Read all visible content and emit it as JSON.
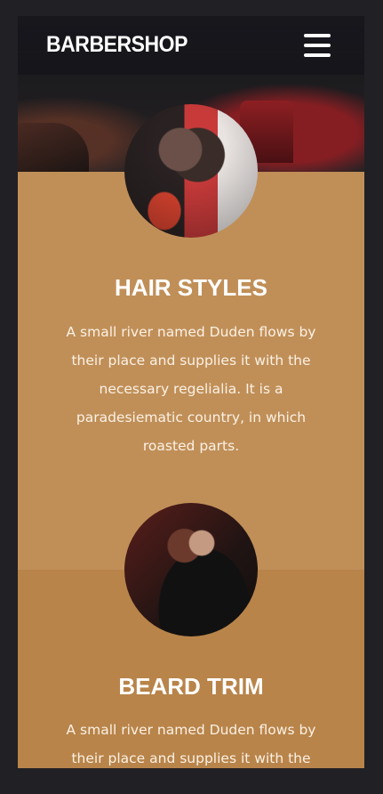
{
  "navbar": {
    "brand": "BARBERSHOP",
    "menu_icon": "hamburger-menu-icon"
  },
  "hero": {
    "image": "barbershop-interior-photo"
  },
  "services": [
    {
      "title": "HAIR STYLES",
      "description": "A small river named Duden flows by their place and supplies it with the necessary regelialia. It is a paradesiematic country, in which roasted parts.",
      "image": "man-getting-haircut-photo"
    },
    {
      "title": "BEARD TRIM",
      "description": "A small river named Duden flows by their place and supplies it with the",
      "image": "man-beard-trim-photo"
    }
  ],
  "colors": {
    "page_background": "#212025",
    "section_primary": "#c08f58",
    "section_secondary": "#b8844a",
    "navbar": "#14141a",
    "text_light": "#ffffff"
  }
}
